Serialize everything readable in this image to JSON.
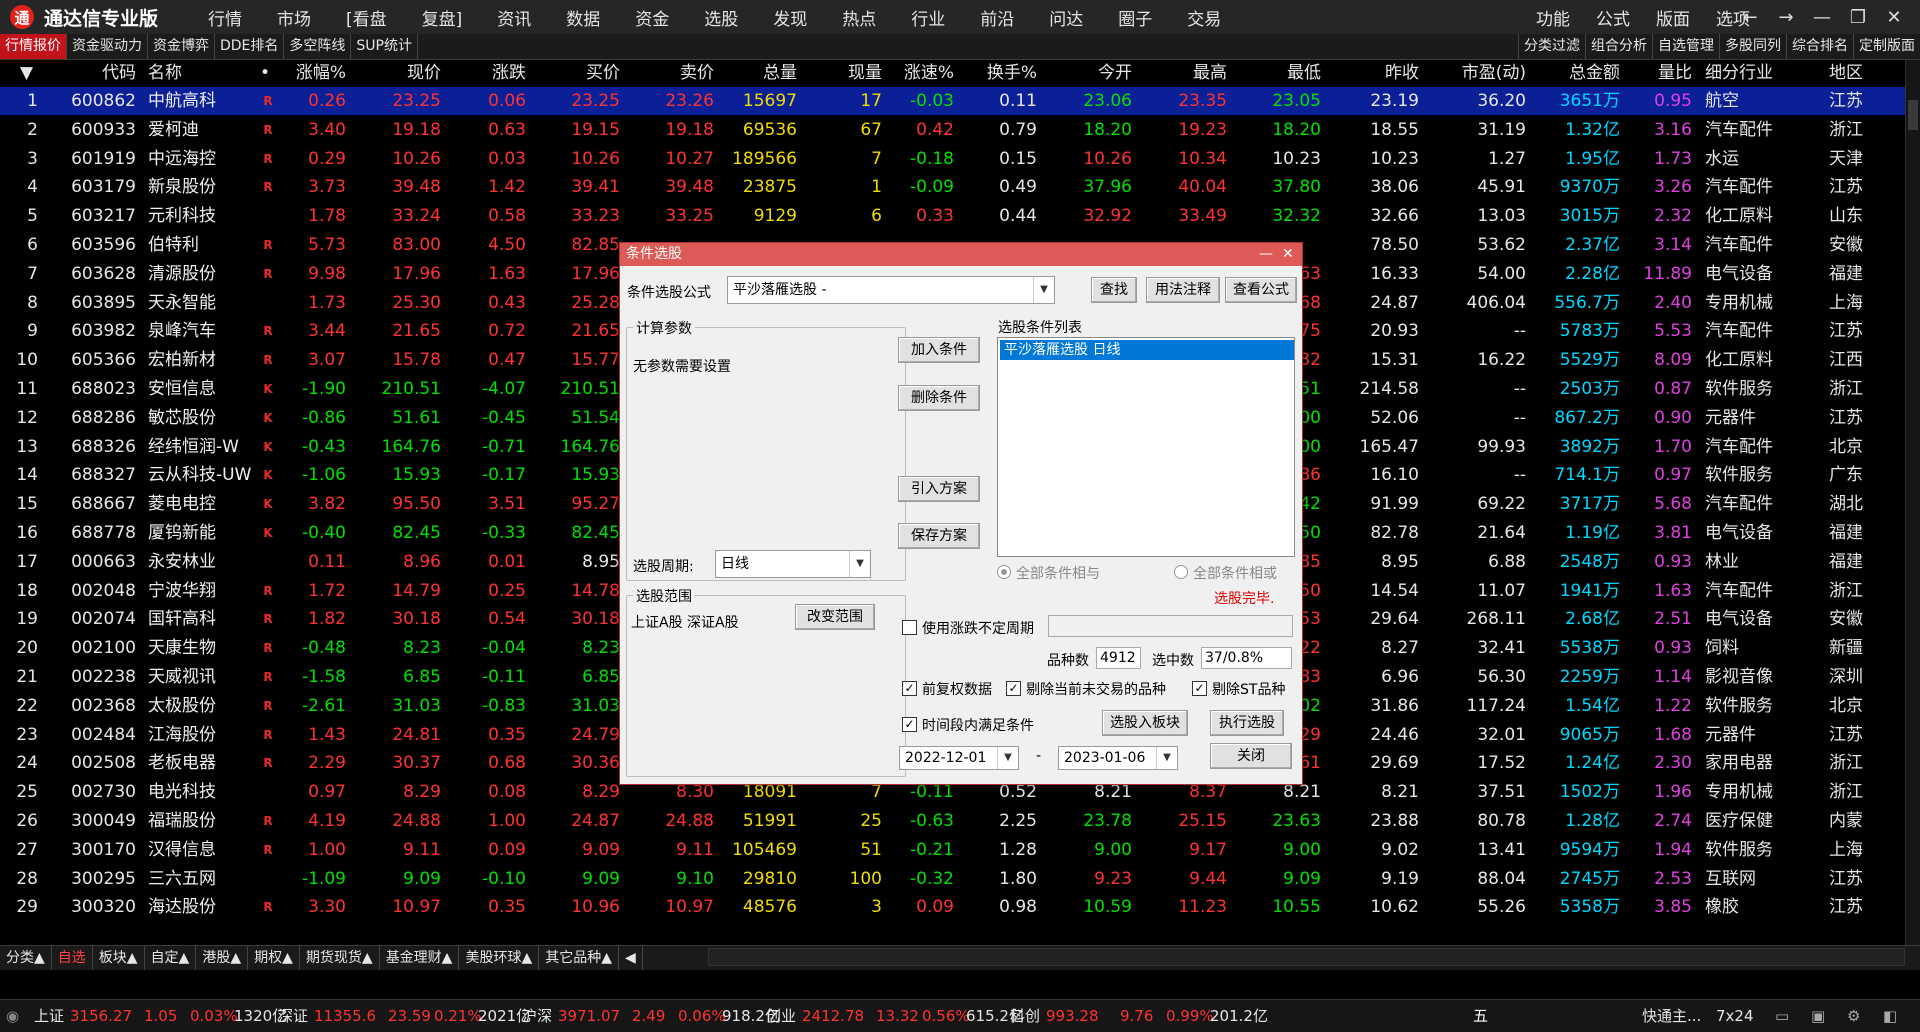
{
  "app": {
    "title": "通达信专业版",
    "logo": "通"
  },
  "menu": [
    "行情",
    "市场",
    "[看盘",
    "复盘]",
    "资讯",
    "数据",
    "资金",
    "选股",
    "发现",
    "热点",
    "行业",
    "前沿",
    "问达",
    "圈子",
    "交易"
  ],
  "right_menu": [
    "功能",
    "公式",
    "版面",
    "选项"
  ],
  "window_controls": {
    "back": "←",
    "forward": "→",
    "minimize": "—",
    "restore": "❐",
    "close": "✕"
  },
  "sub_tabs_left": [
    "行情报价",
    "资金驱动力",
    "资金博弈",
    "DDE排名",
    "多空阵线",
    "SUP统计"
  ],
  "sub_tabs_right": [
    "分类过滤",
    "组合分析",
    "自选管理",
    "多股同列",
    "综合排名",
    "定制版面"
  ],
  "columns": [
    "▼",
    "代码",
    "名称",
    "•",
    "涨幅%",
    "现价",
    "涨跌",
    "买价",
    "卖价",
    "总量",
    "现量",
    "涨速%",
    "换手%",
    "今开",
    "最高",
    "最低",
    "昨收",
    "市盈(动)",
    "总金额",
    "量比",
    "细分行业",
    "地区"
  ],
  "rows": [
    [
      "1",
      "600862",
      "中航高科",
      "R",
      "0.26",
      "23.25",
      "0.06",
      "23.25",
      "23.26",
      "15697",
      "17",
      "-0.03",
      "0.11",
      "23.06",
      "23.35",
      "23.05",
      "23.19",
      "36.20",
      "3651万",
      "0.95",
      "航空",
      "江苏"
    ],
    [
      "2",
      "600933",
      "爱柯迪",
      "R",
      "3.40",
      "19.18",
      "0.63",
      "19.15",
      "19.18",
      "69536",
      "67",
      "0.42",
      "0.79",
      "18.20",
      "19.23",
      "18.20",
      "18.55",
      "31.19",
      "1.32亿",
      "3.16",
      "汽车配件",
      "浙江"
    ],
    [
      "3",
      "601919",
      "中远海控",
      "R",
      "0.29",
      "10.26",
      "0.03",
      "10.26",
      "10.27",
      "189566",
      "7",
      "-0.18",
      "0.15",
      "10.26",
      "10.34",
      "10.23",
      "10.23",
      "1.27",
      "1.95亿",
      "1.73",
      "水运",
      "天津"
    ],
    [
      "4",
      "603179",
      "新泉股份",
      "R",
      "3.73",
      "39.48",
      "1.42",
      "39.41",
      "39.48",
      "23875",
      "1",
      "-0.09",
      "0.49",
      "37.96",
      "40.04",
      "37.80",
      "38.06",
      "45.91",
      "9370万",
      "3.26",
      "汽车配件",
      "江苏"
    ],
    [
      "5",
      "603217",
      "元利科技",
      "",
      "1.78",
      "33.24",
      "0.58",
      "33.23",
      "33.25",
      "9129",
      "6",
      "0.33",
      "0.44",
      "32.92",
      "33.49",
      "32.32",
      "32.66",
      "13.03",
      "3015万",
      "2.32",
      "化工原料",
      "山东"
    ],
    [
      "6",
      "603596",
      "伯特利",
      "R",
      "5.73",
      "83.00",
      "4.50",
      "82.85",
      "",
      "",
      "",
      "",
      "",
      "",
      "",
      "",
      "78.50",
      "53.62",
      "2.37亿",
      "3.14",
      "汽车配件",
      "安徽"
    ],
    [
      "7",
      "603628",
      "清源股份",
      "R",
      "9.98",
      "17.96",
      "1.63",
      "17.96",
      "",
      "",
      "",
      "",
      "",
      "",
      "",
      "63",
      "16.33",
      "54.00",
      "2.28亿",
      "11.89",
      "电气设备",
      "福建"
    ],
    [
      "8",
      "603895",
      "天永智能",
      "",
      "1.73",
      "25.30",
      "0.43",
      "25.28",
      "",
      "",
      "",
      "",
      "",
      "",
      "",
      "68",
      "24.87",
      "406.04",
      "556.7万",
      "2.40",
      "专用机械",
      "上海"
    ],
    [
      "9",
      "603982",
      "泉峰汽车",
      "R",
      "3.44",
      "21.65",
      "0.72",
      "21.65",
      "",
      "",
      "",
      "",
      "",
      "",
      "",
      "75",
      "20.93",
      "--",
      "5783万",
      "5.53",
      "汽车配件",
      "江苏"
    ],
    [
      "10",
      "605366",
      "宏柏新材",
      "R",
      "3.07",
      "15.78",
      "0.47",
      "15.77",
      "",
      "",
      "",
      "",
      "",
      "",
      "",
      "32",
      "15.31",
      "16.22",
      "5529万",
      "8.09",
      "化工原料",
      "江西"
    ],
    [
      "11",
      "688023",
      "安恒信息",
      "K",
      "-1.90",
      "210.51",
      "-4.07",
      "210.51",
      "",
      "",
      "",
      "",
      "",
      "",
      "",
      "51",
      "214.58",
      "--",
      "2503万",
      "0.87",
      "软件服务",
      "浙江"
    ],
    [
      "12",
      "688286",
      "敏芯股份",
      "K",
      "-0.86",
      "51.61",
      "-0.45",
      "51.54",
      "",
      "",
      "",
      "",
      "",
      "",
      "",
      "00",
      "52.06",
      "--",
      "867.2万",
      "0.90",
      "元器件",
      "江苏"
    ],
    [
      "13",
      "688326",
      "经纬恒润-W",
      "K",
      "-0.43",
      "164.76",
      "-0.71",
      "164.76",
      "",
      "",
      "",
      "",
      "",
      "",
      "",
      "00",
      "165.47",
      "99.93",
      "3892万",
      "1.70",
      "汽车配件",
      "北京"
    ],
    [
      "14",
      "688327",
      "云从科技-UW",
      "K",
      "-1.06",
      "15.93",
      "-0.17",
      "15.93",
      "",
      "",
      "",
      "",
      "",
      "",
      "",
      "86",
      "16.10",
      "--",
      "714.1万",
      "0.97",
      "软件服务",
      "广东"
    ],
    [
      "15",
      "688667",
      "菱电电控",
      "K",
      "3.82",
      "95.50",
      "3.51",
      "95.27",
      "",
      "",
      "",
      "",
      "",
      "",
      "",
      "42",
      "91.99",
      "69.22",
      "3717万",
      "5.68",
      "汽车配件",
      "湖北"
    ],
    [
      "16",
      "688778",
      "厦钨新能",
      "K",
      "-0.40",
      "82.45",
      "-0.33",
      "82.45",
      "",
      "",
      "",
      "",
      "",
      "",
      "",
      "50",
      "82.78",
      "21.64",
      "1.19亿",
      "3.81",
      "电气设备",
      "福建"
    ],
    [
      "17",
      "000663",
      "永安林业",
      "",
      "0.11",
      "8.96",
      "0.01",
      "8.95",
      "",
      "",
      "",
      "",
      "",
      "",
      "",
      "85",
      "8.95",
      "6.88",
      "2548万",
      "0.93",
      "林业",
      "福建"
    ],
    [
      "18",
      "002048",
      "宁波华翔",
      "R",
      "1.72",
      "14.79",
      "0.25",
      "14.78",
      "",
      "",
      "",
      "",
      "",
      "",
      "",
      "50",
      "14.54",
      "11.07",
      "1941万",
      "1.63",
      "汽车配件",
      "浙江"
    ],
    [
      "19",
      "002074",
      "国轩高科",
      "R",
      "1.82",
      "30.18",
      "0.54",
      "30.18",
      "",
      "",
      "",
      "",
      "",
      "",
      "",
      "53",
      "29.64",
      "268.11",
      "2.68亿",
      "2.51",
      "电气设备",
      "安徽"
    ],
    [
      "20",
      "002100",
      "天康生物",
      "R",
      "-0.48",
      "8.23",
      "-0.04",
      "8.23",
      "",
      "",
      "",
      "",
      "",
      "",
      "",
      "22",
      "8.27",
      "32.41",
      "5538万",
      "0.93",
      "饲料",
      "新疆"
    ],
    [
      "21",
      "002238",
      "天威视讯",
      "R",
      "-1.58",
      "6.85",
      "-0.11",
      "6.85",
      "",
      "",
      "",
      "",
      "",
      "",
      "",
      "83",
      "6.96",
      "56.30",
      "2259万",
      "1.14",
      "影视音像",
      "深圳"
    ],
    [
      "22",
      "002368",
      "太极股份",
      "R",
      "-2.61",
      "31.03",
      "-0.83",
      "31.03",
      "",
      "",
      "",
      "",
      "",
      "",
      "",
      "02",
      "31.86",
      "117.24",
      "1.54亿",
      "1.22",
      "软件服务",
      "北京"
    ],
    [
      "23",
      "002484",
      "江海股份",
      "R",
      "1.43",
      "24.81",
      "0.35",
      "24.79",
      "",
      "",
      "",
      "",
      "",
      "",
      "",
      "29",
      "24.46",
      "32.01",
      "9065万",
      "1.68",
      "元器件",
      "江苏"
    ],
    [
      "24",
      "002508",
      "老板电器",
      "R",
      "2.29",
      "30.37",
      "0.68",
      "30.36",
      "",
      "",
      "",
      "",
      "",
      "",
      "",
      "61",
      "29.69",
      "17.52",
      "1.24亿",
      "2.30",
      "家用电器",
      "浙江"
    ],
    [
      "25",
      "002730",
      "电光科技",
      "",
      "0.97",
      "8.29",
      "0.08",
      "8.29",
      "8.30",
      "18091",
      "7",
      "-0.11",
      "0.52",
      "8.21",
      "8.37",
      "8.21",
      "8.21",
      "37.51",
      "1502万",
      "1.96",
      "专用机械",
      "浙江"
    ],
    [
      "26",
      "300049",
      "福瑞股份",
      "R",
      "4.19",
      "24.88",
      "1.00",
      "24.87",
      "24.88",
      "51991",
      "25",
      "-0.63",
      "2.25",
      "23.78",
      "25.15",
      "23.63",
      "23.88",
      "80.78",
      "1.28亿",
      "2.74",
      "医疗保健",
      "内蒙"
    ],
    [
      "27",
      "300170",
      "汉得信息",
      "R",
      "1.00",
      "9.11",
      "0.09",
      "9.09",
      "9.11",
      "105469",
      "51",
      "-0.21",
      "1.28",
      "9.00",
      "9.17",
      "9.00",
      "9.02",
      "13.41",
      "9594万",
      "1.94",
      "软件服务",
      "上海"
    ],
    [
      "28",
      "300295",
      "三六五网",
      "",
      "-1.09",
      "9.09",
      "-0.10",
      "9.09",
      "9.10",
      "29810",
      "100",
      "-0.32",
      "1.80",
      "9.23",
      "9.44",
      "9.09",
      "9.19",
      "88.04",
      "2745万",
      "2.53",
      "互联网",
      "江苏"
    ],
    [
      "29",
      "300320",
      "海达股份",
      "R",
      "3.30",
      "10.97",
      "0.35",
      "10.96",
      "10.97",
      "48576",
      "3",
      "0.09",
      "0.98",
      "10.59",
      "11.23",
      "10.55",
      "10.62",
      "55.26",
      "5358万",
      "3.85",
      "橡胶",
      "江苏"
    ]
  ],
  "bottom_tabs": [
    "分类▲",
    "自选",
    "板块▲",
    "自定▲",
    "港股▲",
    "期权▲",
    "期货现货▲",
    "基金理财▲",
    "美股环球▲",
    "其它品种▲",
    "◀"
  ],
  "status": [
    {
      "label": "上证",
      "value": "3156.27",
      "chg": "1.05",
      "pct": "0.03%",
      "amt": "1320亿"
    },
    {
      "label": "深证",
      "value": "11355.6",
      "chg": "23.59",
      "pct": "0.21%",
      "amt": "2021亿"
    },
    {
      "label": "沪深",
      "value": "3971.07",
      "chg": "2.49",
      "pct": "0.06%",
      "amt": "918.2亿"
    },
    {
      "label": "创业",
      "value": "2412.78",
      "chg": "13.32",
      "pct": "0.56%",
      "amt": "615.2亿"
    },
    {
      "label": "科创",
      "value": "993.28",
      "chg": "9.76",
      "pct": "0.99%",
      "amt": "201.2亿"
    }
  ],
  "status_right": {
    "ime": "五",
    "broker": "快通主...",
    "clock": "7x24"
  },
  "dialog": {
    "title": "条件选股",
    "formula_label": "条件选股公式",
    "formula_value": "平沙落雁选股 -",
    "btn_find": "查找",
    "btn_usage": "用法注释",
    "btn_view": "查看公式",
    "params_group": "计算参数",
    "params_text": "无参数需要设置",
    "period_label": "选股周期:",
    "period_value": "日线",
    "btn_add": "加入条件",
    "btn_delete": "删除条件",
    "btn_import": "引入方案",
    "btn_save": "保存方案",
    "list_label": "选股条件列表",
    "list_items": [
      "平沙落雁选股  日线"
    ],
    "radio_and": "全部条件相与",
    "radio_or": "全部条件相或",
    "done_text": "选股完毕.",
    "range_group": "选股范围",
    "range_text": "上证A股 深证A股",
    "btn_change_range": "改变范围",
    "chk_float_period": "使用涨跌不定周期",
    "count_label": "品种数",
    "count_value": "4912",
    "selected_label": "选中数",
    "selected_value": "37/0.8%",
    "chk_adjust": "前复权数据",
    "chk_remove_untraded": "剔除当前未交易的品种",
    "chk_remove_st": "剔除ST品种",
    "chk_time_range": "时间段内满足条件",
    "btn_to_block": "选股入板块",
    "btn_execute": "执行选股",
    "date_from": "2022-12-01",
    "date_sep": "-",
    "date_to": "2023-01-06",
    "btn_close": "关闭"
  }
}
